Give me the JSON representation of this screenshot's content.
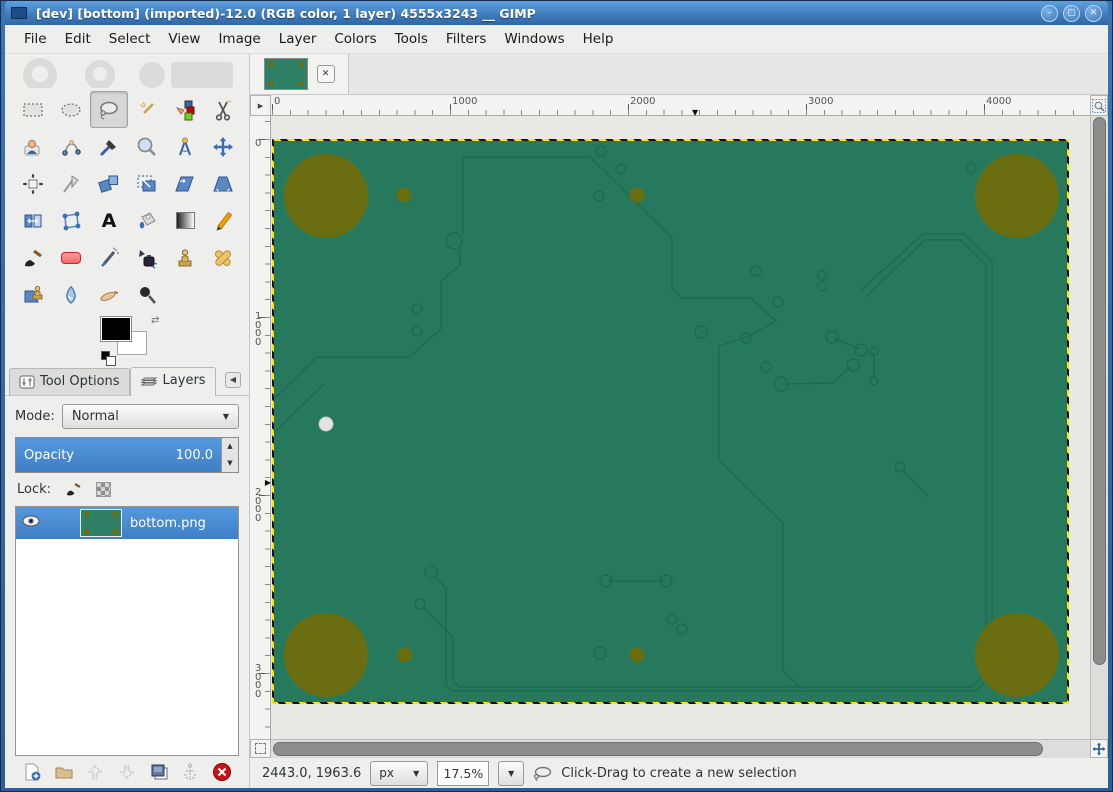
{
  "window": {
    "title": "[dev] [bottom] (imported)-12.0 (RGB color, 1 layer) 4555x3243 __ GIMP",
    "controls": {
      "minimize": "–",
      "maximize": "▢",
      "close": "✕"
    }
  },
  "menu": {
    "items": [
      "File",
      "Edit",
      "Select",
      "View",
      "Image",
      "Layer",
      "Colors",
      "Tools",
      "Filters",
      "Windows",
      "Help"
    ]
  },
  "toolbox": {
    "tool_names": [
      "rectangle-select",
      "ellipse-select",
      "free-select",
      "fuzzy-select",
      "select-by-color",
      "scissors-select",
      "foreground-select",
      "paths",
      "color-picker",
      "zoom",
      "measure",
      "move",
      "alignment",
      "crop",
      "rotate",
      "scale",
      "shear",
      "perspective",
      "flip",
      "cage-transform",
      "text",
      "bucket-fill",
      "gradient",
      "pencil",
      "paintbrush",
      "eraser",
      "airbrush",
      "ink",
      "clone",
      "heal",
      "perspective-clone",
      "blur-sharpen",
      "smudge",
      "dodge-burn"
    ],
    "active_tool": "free-select",
    "text_tool_glyph": "A"
  },
  "dock": {
    "tabs": [
      {
        "label": "Tool Options",
        "active": false
      },
      {
        "label": "Layers",
        "active": true
      }
    ],
    "collapse_icon": "◀",
    "mode": {
      "label": "Mode:",
      "value": "Normal"
    },
    "opacity": {
      "label": "Opacity",
      "value": "100.0"
    },
    "lock": {
      "label": "Lock:"
    },
    "layers": [
      {
        "name": "bottom.png",
        "visible": true,
        "selected": true
      }
    ]
  },
  "icons": {
    "dropdown_arrow": "▼",
    "spin_up": "▲",
    "spin_down": "▼",
    "corner_play": "▶",
    "marker_down": "▼",
    "marker_right": "▶",
    "swap_arrows": "⇄",
    "tab_close": "✕"
  },
  "canvas": {
    "h_ruler_labels": [
      "0",
      "1000",
      "2000",
      "3000",
      "4000"
    ],
    "v_ruler_labels": [
      "0",
      "1\n0\n0\n0",
      "2\n0\n0\n0",
      "3\n0\n0\n0"
    ],
    "image": {
      "name": "bottom.png",
      "board_color": "#27795d",
      "pad_color": "#6b6e10",
      "trace_color": "#1d6a50"
    },
    "statusbar": {
      "position": "2443.0, 1963.6",
      "unit": "px",
      "zoom": "17.5%",
      "message": "Click-Drag to create a new selection"
    }
  }
}
